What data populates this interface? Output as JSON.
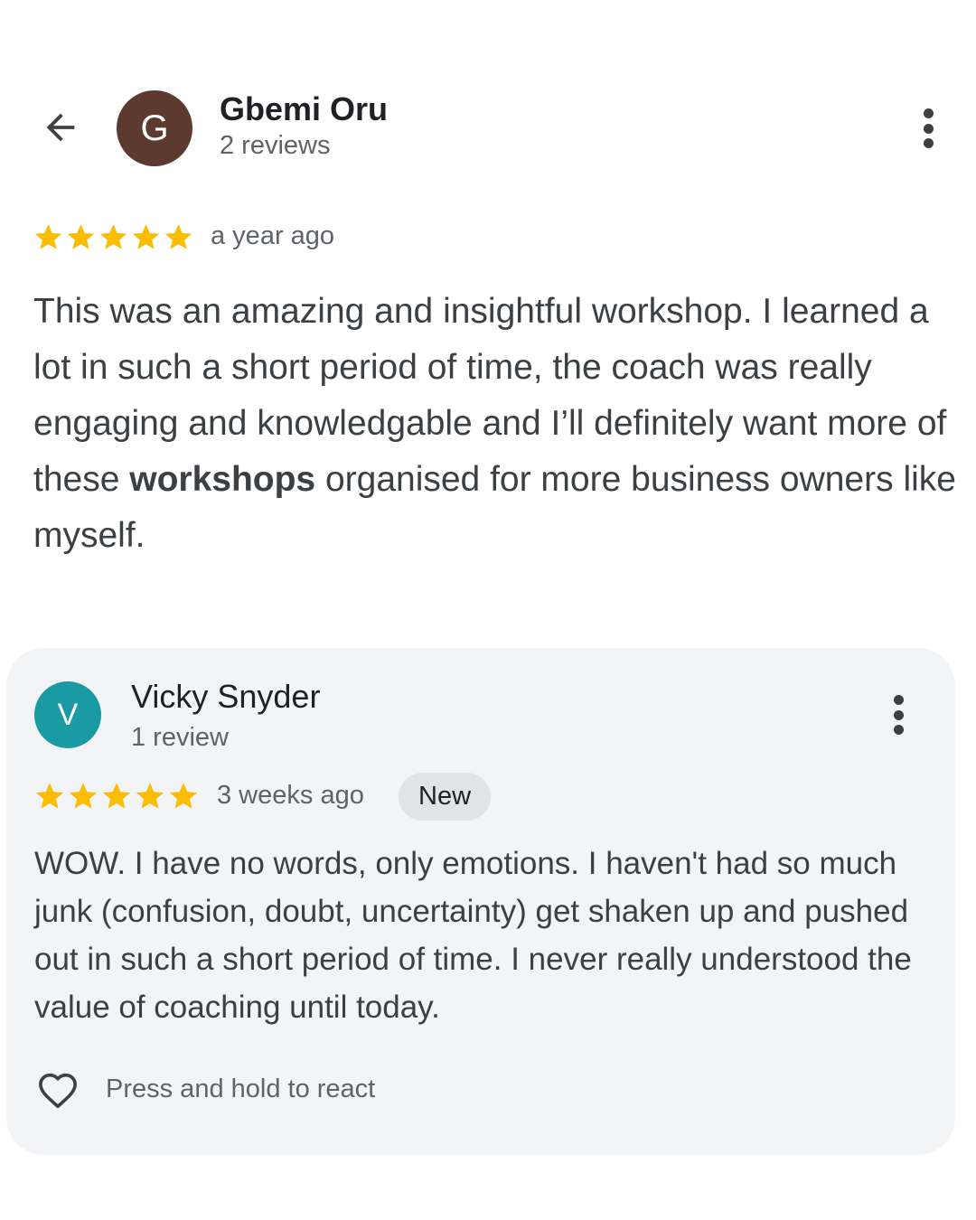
{
  "colors": {
    "star": "#fbbc04",
    "avatar_1_bg": "#5c3a30",
    "avatar_2_bg": "#1a9ba3",
    "card_bg": "#f3f4f6",
    "badge_bg": "#e2e3e5"
  },
  "header": {
    "back_icon": "arrow-left-icon",
    "more_icon": "more-vert-icon"
  },
  "review_1": {
    "avatar_letter": "G",
    "name": "Gbemi Oru",
    "review_count": "2 reviews",
    "rating": 5,
    "max_rating": 5,
    "time": "a year ago",
    "text_before_bold": "This was an amazing and insightful workshop. I learned a lot in such a short period of time, the coach was really engaging and knowledgable and I’ll definitely want more of these ",
    "text_bold": "workshops",
    "text_after_bold": " organised for more business owners like myself."
  },
  "review_2": {
    "avatar_letter": "V",
    "name": "Vicky Snyder",
    "review_count": "1 review",
    "rating": 5,
    "max_rating": 5,
    "time": "3 weeks ago",
    "badge": "New",
    "text": "WOW. I have no words, only emotions. I haven't had so much junk (confusion, doubt, uncertainty) get shaken up and pushed out in such a short period of time. I never really understood the value of coaching until today.",
    "react_icon": "heart-outline-icon",
    "react_label": "Press and hold to react"
  }
}
